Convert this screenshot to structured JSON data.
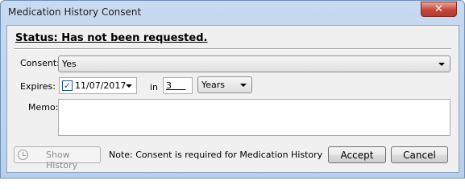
{
  "window": {
    "title": "Medication History Consent",
    "close_glyph": "✕"
  },
  "status_text": "Status: Has not been requested.",
  "consent": {
    "label": "Consent:",
    "value": "Yes"
  },
  "expires": {
    "label": "Expires:",
    "checked": true,
    "check_glyph": "✓",
    "date": "11/07/2017",
    "in_label": "in",
    "number": "3",
    "unit": "Years"
  },
  "memo": {
    "label": "Memo:",
    "value": ""
  },
  "footer": {
    "show_history_label": "Show History",
    "note": "Note: Consent is required for Medication History",
    "accept_label": "Accept",
    "cancel_label": "Cancel"
  },
  "icons": {
    "history": "clock-icon",
    "close": "close-icon",
    "dropdown": "chevron-down-icon"
  }
}
